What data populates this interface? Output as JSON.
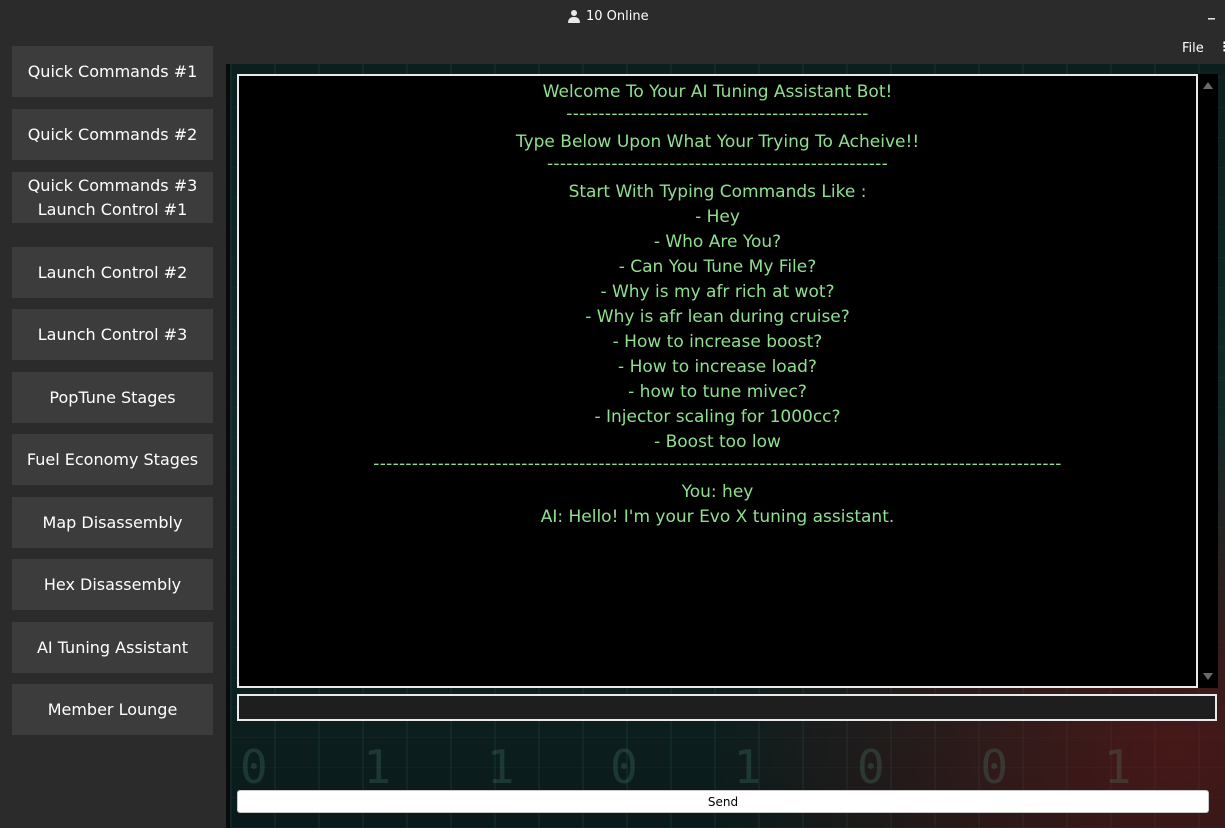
{
  "titlebar": {
    "online_text": "10 Online",
    "minimize_glyph": "_"
  },
  "menubar": {
    "file_label": "File",
    "more_glyph": "⋮"
  },
  "sidebar": {
    "items": [
      {
        "label": "Quick Commands #1"
      },
      {
        "label": "Quick Commands #2"
      },
      {
        "label": "Quick Commands #3\nLaunch Control #1"
      },
      {
        "label": "Launch Control #2"
      },
      {
        "label": "Launch Control #3"
      },
      {
        "label": "PopTune Stages"
      },
      {
        "label": "Fuel Economy Stages"
      },
      {
        "label": "Map Disassembly"
      },
      {
        "label": "Hex Disassembly"
      },
      {
        "label": "AI Tuning Assistant"
      },
      {
        "label": "Member Lounge"
      }
    ]
  },
  "chat": {
    "lines": [
      "Welcome To Your AI Tuning Assistant Bot!",
      "-----------------------------------------------",
      "Type Below Upon What Your Trying To Acheive!!",
      "-----------------------------------------------------",
      "Start With Typing Commands Like :",
      "- Hey",
      "- Who Are You?",
      "- Can You Tune My File?",
      "- Why is my afr rich at wot?",
      "- Why is afr lean during cruise?",
      "- How to increase boost?",
      "- How to increase load?",
      "- how to tune mivec?",
      "- Injector scaling for 1000cc?",
      "- Boost too low",
      "-----------------------------------------------------------------------------------------------------------",
      "You: hey",
      "AI: Hello! I'm your Evo X tuning assistant."
    ],
    "input_value": "",
    "send_label": "Send"
  },
  "colors": {
    "chat_text": "#8ee08e",
    "chat_bg": "#000000",
    "sidebar_button": "#3c3c3c",
    "window_bg": "#2b2b2b"
  }
}
